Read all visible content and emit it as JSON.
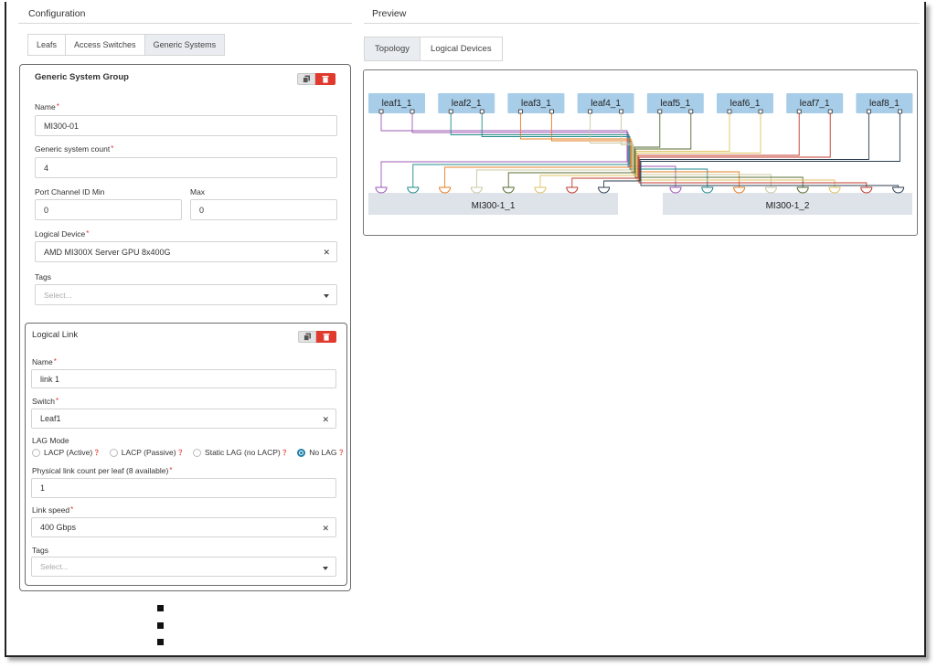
{
  "configuration": {
    "title": "Configuration",
    "tabs": [
      {
        "label": "Leafs",
        "active": false
      },
      {
        "label": "Access Switches",
        "active": false
      },
      {
        "label": "Generic Systems",
        "active": true
      }
    ],
    "group": {
      "title": "Generic System Group",
      "name_label": "Name",
      "name_value": "MI300-01",
      "count_label": "Generic system count",
      "count_value": "4",
      "port_min_label": "Port Channel ID Min",
      "port_min_value": "0",
      "port_max_label": "Max",
      "port_max_value": "0",
      "logical_device_label": "Logical Device",
      "logical_device_value": "AMD MI300X Server GPU 8x400G",
      "tags_label": "Tags",
      "tags_placeholder": "Select..."
    },
    "link": {
      "title": "Logical Link",
      "name_label": "Name",
      "name_value": "link 1",
      "switch_label": "Switch",
      "switch_value": "Leaf1",
      "lag_mode_label": "LAG Mode",
      "lag_options": [
        {
          "label": "LACP (Active)",
          "selected": false
        },
        {
          "label": "LACP (Passive)",
          "selected": false
        },
        {
          "label": "Static LAG (no LACP)",
          "selected": false
        },
        {
          "label": "No LAG",
          "selected": true
        }
      ],
      "physical_count_label": "Physical link count per leaf (8 available)",
      "physical_count_value": "1",
      "speed_label": "Link speed",
      "speed_value": "400 Gbps",
      "tags_label": "Tags",
      "tags_placeholder": "Select..."
    }
  },
  "preview": {
    "title": "Preview",
    "tabs": [
      {
        "label": "Topology",
        "active": true
      },
      {
        "label": "Logical Devices",
        "active": false
      }
    ],
    "leafs": [
      "leaf1_1",
      "leaf2_1",
      "leaf3_1",
      "leaf4_1",
      "leaf5_1",
      "leaf6_1",
      "leaf7_1",
      "leaf8_1"
    ],
    "systems": [
      "MI300-1_1",
      "MI300-1_2"
    ],
    "link_colors": [
      "#9b59b6",
      "#1f8a8a",
      "#e67e22",
      "#c8c8a0",
      "#556b2f",
      "#e0c060",
      "#c0392b",
      "#2c3e50"
    ],
    "leaf_color": "#a8cde8",
    "system_color": "#dde3e9"
  },
  "icons": {
    "copy": "copy-icon",
    "delete": "trash-icon",
    "clear": "clear-x-icon",
    "dropdown": "chevron-down-icon",
    "help": "question-icon"
  }
}
